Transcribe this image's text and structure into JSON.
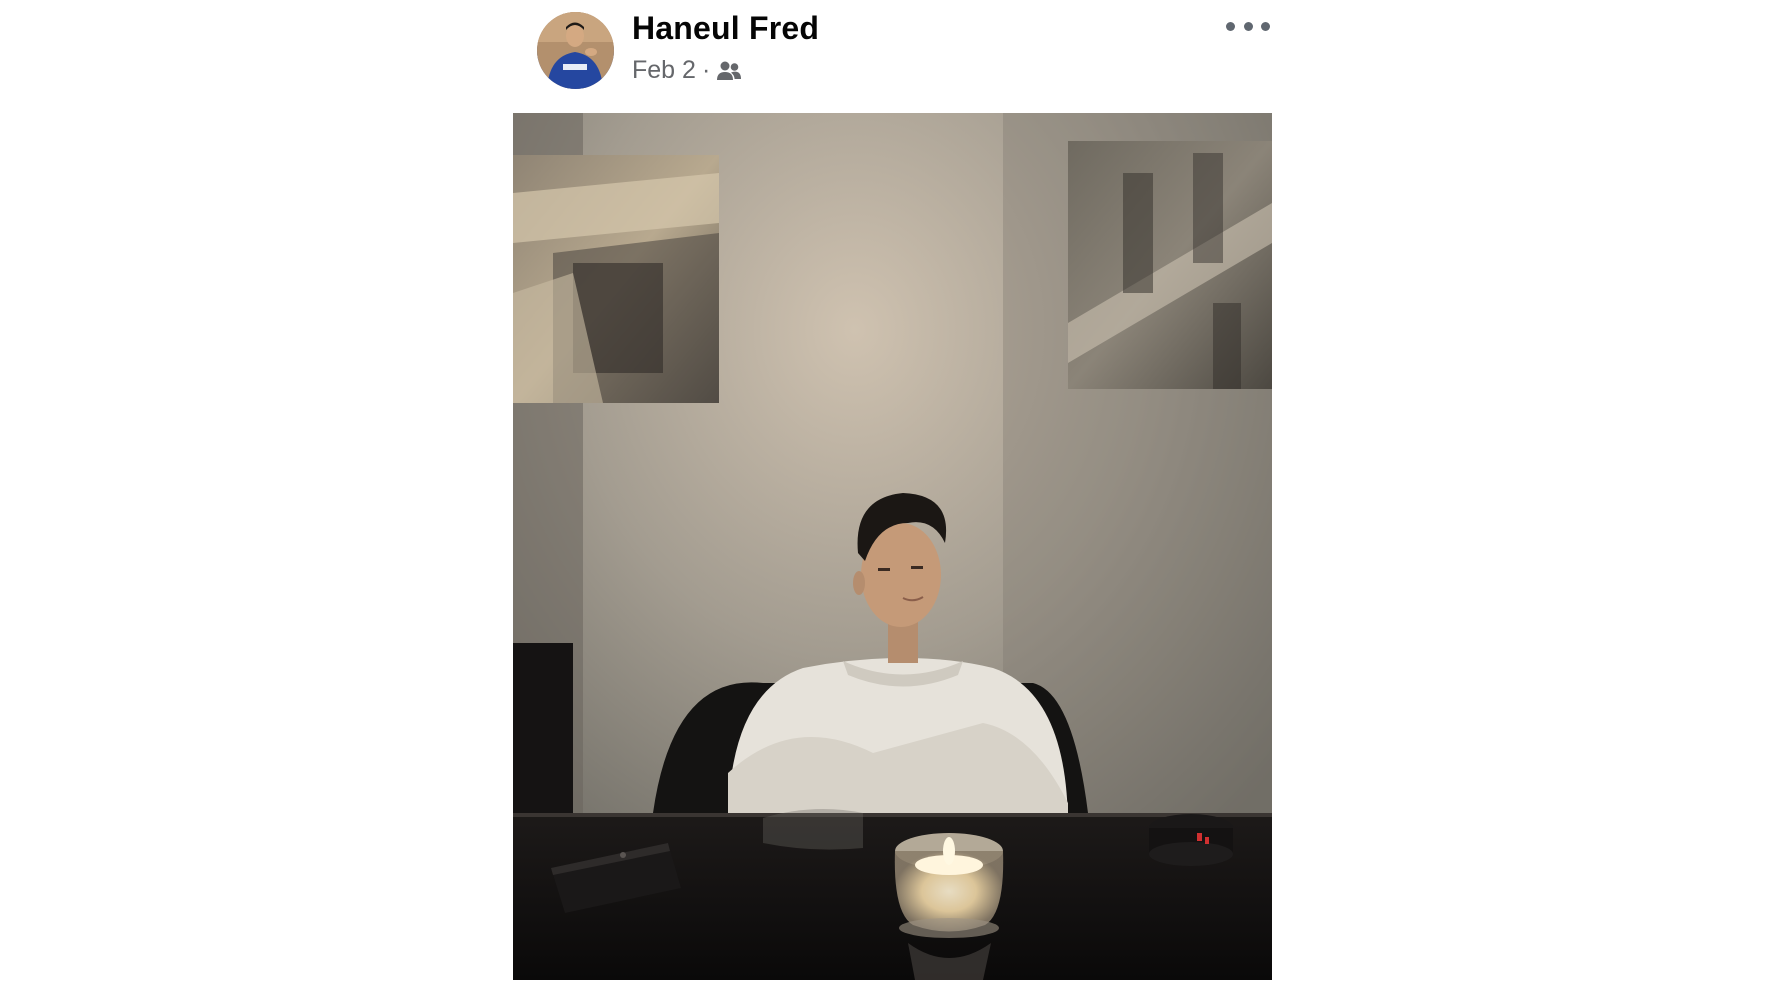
{
  "post": {
    "author_name": "Haneul Fred",
    "date": "Feb 2",
    "separator": "·",
    "audience_icon": "friends-icon",
    "more_icon": "more-options-icon"
  },
  "photo": {
    "icon": "post-photo"
  }
}
